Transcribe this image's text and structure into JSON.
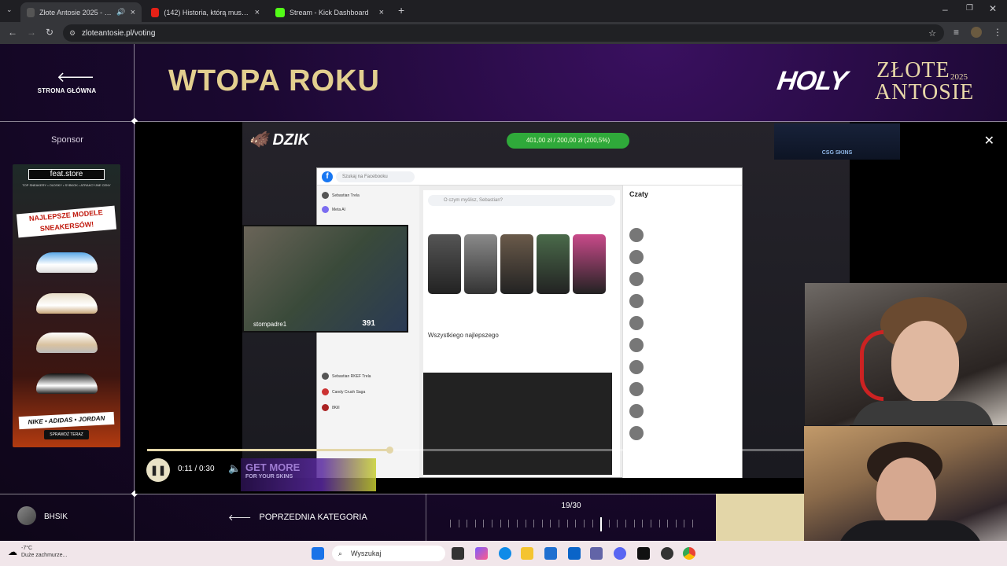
{
  "browser": {
    "tabs": [
      {
        "title": "Złote Antosie 2025 - Najwię",
        "active": true
      },
      {
        "title": "(142) Historia, którą musisz zna",
        "active": false
      },
      {
        "title": "Stream - Kick Dashboard",
        "active": false
      }
    ],
    "url": "zloteantosie.pl/voting"
  },
  "header": {
    "back_label": "STRONA GŁÓWNA",
    "category_title": "WTOPA ROKU",
    "logo_holy": "HOLY",
    "logo_line1": "ZŁOTE",
    "logo_line2": "ANTOSIE",
    "logo_year": "2025"
  },
  "sponsor": {
    "label": "Sponsor",
    "store": "feat.store",
    "tagline": "TOP SNEAKERY • OLDSKY • SYBKOK • ATRAKCYJNE CENY",
    "headline": "NAJLEPSZE MODELE SNEAKERSÓW!",
    "brands": "NIKE • ADIDAS • JORDAN",
    "cta": "SPRAWDŹ TERAZ"
  },
  "video": {
    "time": "0:11 / 0:30",
    "progress": 0.3667,
    "overlay_brand": "DZIK",
    "donation": "401,00 zł / 200,00 zł (200,5%)",
    "csg_label": "CSG SKINS",
    "cam_name": "stompadre1",
    "cam_count": "391",
    "ad_headline": "GET MORE",
    "ad_sub": "FOR YOUR SKINS",
    "fb": {
      "search_placeholder": "Szukaj na Facebooku",
      "post_placeholder": "O czym myślisz, Sebastian?",
      "post_text": "Wszystkiego najlepszego",
      "chats_title": "Czaty",
      "left_items": [
        "Sebastian Trela",
        "Meta AI"
      ],
      "recent_items": [
        "Sebastian RKEF Trela",
        "Candy Crush Saga",
        "8Kill"
      ]
    }
  },
  "footer": {
    "user": "BHSIK",
    "prev_category": "POPRZEDNIA KATEGORIA",
    "count": "19/30",
    "current": 19,
    "total": 30
  },
  "taskbar": {
    "temp": "-7°C",
    "weather": "Duże zachmurze...",
    "search": "Wyszukaj"
  },
  "colors": {
    "gold": "#e3cf8f",
    "accent_fill": "#e3d6a8",
    "page_bg": "#1a0830"
  }
}
